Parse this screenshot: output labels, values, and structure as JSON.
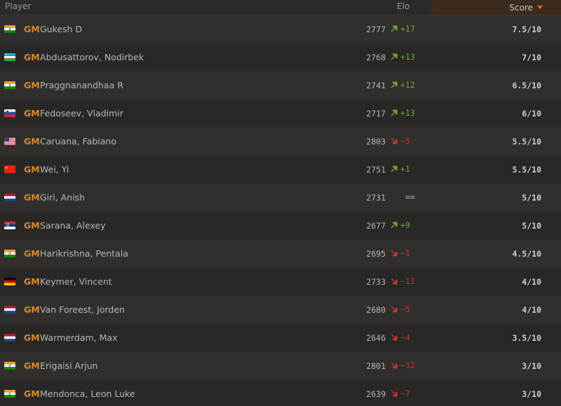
{
  "header": {
    "player": "Player",
    "elo": "Elo",
    "score": "Score"
  },
  "colors": {
    "title": "#d88a29",
    "up": "#72a83a",
    "down": "#cc3333",
    "sort_accent": "#e36a2b"
  },
  "players": [
    {
      "flag": "IN",
      "title": "GM",
      "name": "Gukesh D",
      "elo": "2777",
      "trend": "up",
      "diff": "+17",
      "score": "7.5/10"
    },
    {
      "flag": "UZ",
      "title": "GM",
      "name": "Abdusattorov, Nodirbek",
      "elo": "2768",
      "trend": "up",
      "diff": "+13",
      "score": "7/10"
    },
    {
      "flag": "IN",
      "title": "GM",
      "name": "Praggnanandhaa R",
      "elo": "2741",
      "trend": "up",
      "diff": "+12",
      "score": "6.5/10"
    },
    {
      "flag": "SI",
      "title": "GM",
      "name": "Fedoseev, Vladimir",
      "elo": "2717",
      "trend": "up",
      "diff": "+13",
      "score": "6/10"
    },
    {
      "flag": "US",
      "title": "GM",
      "name": "Caruana, Fabiano",
      "elo": "2803",
      "trend": "down",
      "diff": "−5",
      "score": "5.5/10"
    },
    {
      "flag": "CN",
      "title": "GM",
      "name": "Wei, Yi",
      "elo": "2751",
      "trend": "up",
      "diff": "+1",
      "score": "5.5/10"
    },
    {
      "flag": "NL",
      "title": "GM",
      "name": "Giri, Anish",
      "elo": "2731",
      "trend": "eq",
      "diff": "==",
      "score": "5/10"
    },
    {
      "flag": "RS",
      "title": "GM",
      "name": "Sarana, Alexey",
      "elo": "2677",
      "trend": "up",
      "diff": "+9",
      "score": "5/10"
    },
    {
      "flag": "IN",
      "title": "GM",
      "name": "Harikrishna, Pentala",
      "elo": "2695",
      "trend": "down",
      "diff": "−1",
      "score": "4.5/10"
    },
    {
      "flag": "DE",
      "title": "GM",
      "name": "Keymer, Vincent",
      "elo": "2733",
      "trend": "down",
      "diff": "−11",
      "score": "4/10"
    },
    {
      "flag": "NL",
      "title": "GM",
      "name": "Van Foreest, Jorden",
      "elo": "2680",
      "trend": "down",
      "diff": "−5",
      "score": "4/10"
    },
    {
      "flag": "NL",
      "title": "GM",
      "name": "Warmerdam, Max",
      "elo": "2646",
      "trend": "down",
      "diff": "−4",
      "score": "3.5/10"
    },
    {
      "flag": "IN",
      "title": "GM",
      "name": "Erigaisi Arjun",
      "elo": "2801",
      "trend": "down",
      "diff": "−32",
      "score": "3/10"
    },
    {
      "flag": "IN",
      "title": "GM",
      "name": "Mendonca, Leon Luke",
      "elo": "2639",
      "trend": "down",
      "diff": "−7",
      "score": "3/10"
    }
  ]
}
